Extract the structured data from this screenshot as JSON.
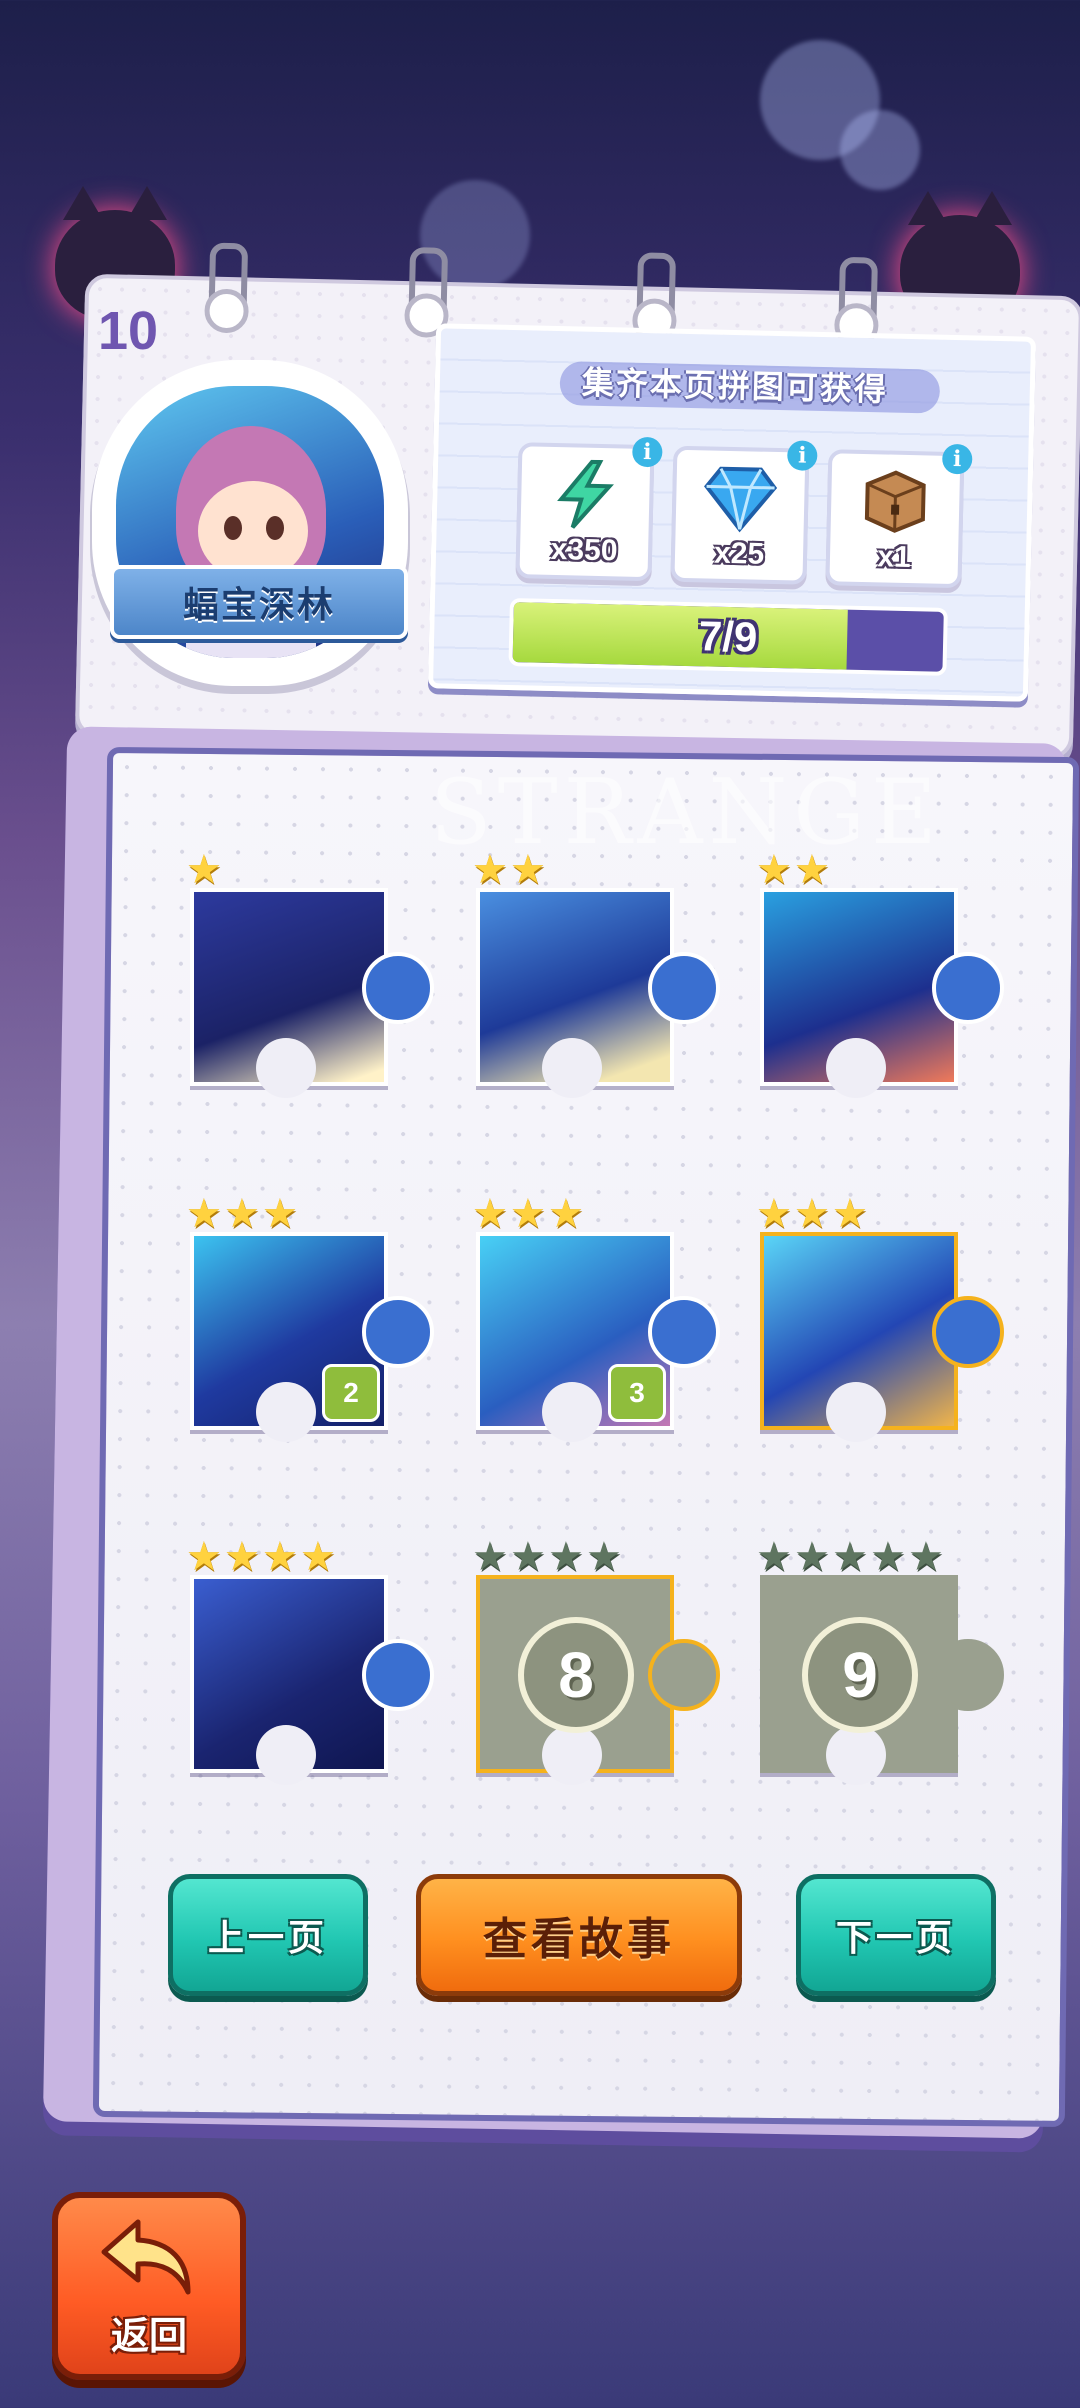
{
  "level": {
    "number": "10"
  },
  "stage": {
    "name": "蝠宝深林"
  },
  "rewards": {
    "title": "集齐本页拼图可获得",
    "items": [
      {
        "icon": "lightning-icon",
        "qty": "x350",
        "color": "#3fd6a3"
      },
      {
        "icon": "diamond-icon",
        "qty": "x25",
        "color": "#39a8f0"
      },
      {
        "icon": "chest-icon",
        "qty": "x1",
        "color": "#b77a45"
      }
    ],
    "progress": {
      "text": "7/9",
      "collected": 7,
      "total": 9
    }
  },
  "watermark": "STRANGE",
  "pieces": [
    {
      "stars": 1,
      "max_stars": 1,
      "unlocked": true
    },
    {
      "stars": 2,
      "max_stars": 2,
      "unlocked": true
    },
    {
      "stars": 2,
      "max_stars": 2,
      "unlocked": true
    },
    {
      "stars": 3,
      "max_stars": 3,
      "unlocked": true,
      "badge": "2"
    },
    {
      "stars": 3,
      "max_stars": 3,
      "unlocked": true,
      "badge": "3"
    },
    {
      "stars": 3,
      "max_stars": 3,
      "unlocked": true
    },
    {
      "stars": 4,
      "max_stars": 4,
      "unlocked": true
    },
    {
      "stars": 0,
      "max_stars": 4,
      "unlocked": false,
      "label": "8"
    },
    {
      "stars": 0,
      "max_stars": 5,
      "unlocked": false,
      "label": "9"
    }
  ],
  "buttons": {
    "prev": "上一页",
    "story": "查看故事",
    "next": "下一页",
    "back": "返回"
  }
}
